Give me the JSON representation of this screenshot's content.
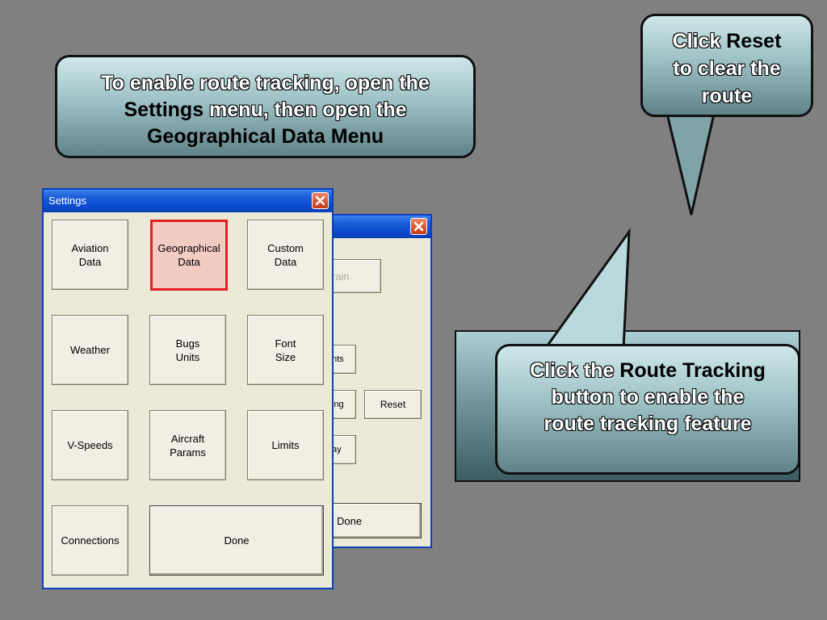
{
  "callouts": {
    "top": {
      "line1": "To enable route tracking, open the",
      "settings_word": "Settings",
      "line2_rest": " menu, then open the",
      "line3": "Geographical Data Menu"
    },
    "reset": {
      "click": "Click ",
      "reset_word": "Reset",
      "line2": "to clear the",
      "line3": "route"
    },
    "route": {
      "click": "Click the ",
      "route_word": "Route Tracking",
      "line2": "button to enable the",
      "line3": "route tracking feature"
    }
  },
  "background_window": {
    "buttons": {
      "terrain": "rain",
      "points": "nts",
      "route_tracking": "ing",
      "reset": "Reset",
      "display": "ay",
      "done": "Done"
    }
  },
  "settings_window": {
    "title": "Settings",
    "buttons": {
      "aviation_data": "Aviation\nData",
      "geographical_data": "Geographical\nData",
      "custom_data": "Custom\nData",
      "weather": "Weather",
      "bugs_units": "Bugs\nUnits",
      "font_size": "Font\nSize",
      "v_speeds": "V-Speeds",
      "aircraft_params": "Aircraft\nParams",
      "limits": "Limits",
      "connections": "Connections",
      "done": "Done"
    }
  },
  "colors": {
    "desktop": "#808080",
    "xp_title": "#0c4bd0",
    "highlight_border": "#e31e1e",
    "highlight_fill": "#f2cbc2"
  }
}
